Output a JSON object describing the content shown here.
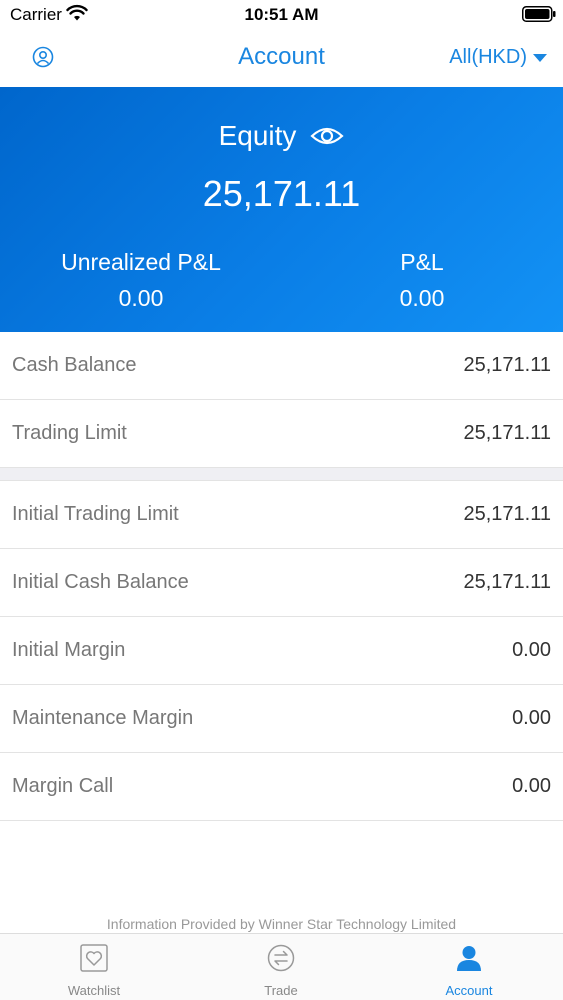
{
  "status_bar": {
    "carrier": "Carrier",
    "time": "10:51 AM"
  },
  "nav": {
    "title": "Account",
    "account_selector": "All(HKD)"
  },
  "hero": {
    "equity_label": "Equity",
    "equity_value": "25,171.11",
    "unrealized_pl_label": "Unrealized P&L",
    "unrealized_pl_value": "0.00",
    "pl_label": "P&L",
    "pl_value": "0.00"
  },
  "section1": [
    {
      "label": "Cash Balance",
      "value": "25,171.11"
    },
    {
      "label": "Trading Limit",
      "value": "25,171.11"
    }
  ],
  "section2": [
    {
      "label": "Initial Trading Limit",
      "value": "25,171.11"
    },
    {
      "label": "Initial Cash Balance",
      "value": "25,171.11"
    },
    {
      "label": "Initial Margin",
      "value": "0.00"
    },
    {
      "label": "Maintenance Margin",
      "value": "0.00"
    },
    {
      "label": "Margin Call",
      "value": "0.00"
    }
  ],
  "footer": {
    "info": "Information Provided by Winner Star Technology Limited"
  },
  "tabs": [
    {
      "label": "Watchlist",
      "icon": "heart-icon"
    },
    {
      "label": "Trade",
      "icon": "exchange-icon"
    },
    {
      "label": "Account",
      "icon": "person-icon"
    }
  ],
  "colors": {
    "accent": "#1a86e0",
    "hero_start": "#0066cc",
    "hero_end": "#1392f5"
  }
}
